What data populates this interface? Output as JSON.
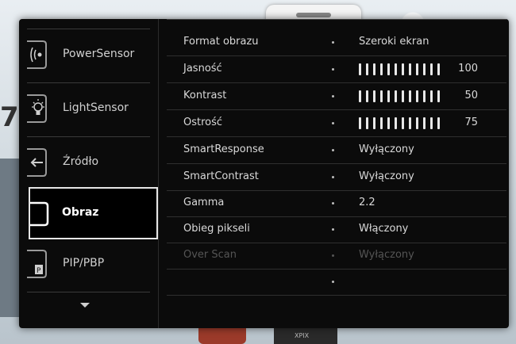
{
  "background": {
    "corner_digit": "7",
    "device_label": "XPIX"
  },
  "sidebar": {
    "items": [
      {
        "label": "PowerSensor",
        "icon": "power-sensor-icon"
      },
      {
        "label": "LightSensor",
        "icon": "light-sensor-icon"
      },
      {
        "label": "Źródło",
        "icon": "input-source-icon"
      },
      {
        "label": "Obraz",
        "icon": "picture-icon",
        "active": true
      },
      {
        "label": "PIP/PBP",
        "icon": "pip-icon"
      }
    ],
    "more_icon": "chevron-down-icon"
  },
  "settings": [
    {
      "name": "Format obrazu",
      "value": "Szeroki ekran"
    },
    {
      "name": "Jasność",
      "level": 100,
      "level_label": "100"
    },
    {
      "name": "Kontrast",
      "level": 50,
      "level_label": "50"
    },
    {
      "name": "Ostrość",
      "level": 75,
      "level_label": "75"
    },
    {
      "name": "SmartResponse",
      "value": "Wyłączony"
    },
    {
      "name": "SmartContrast",
      "value": "Wyłączony"
    },
    {
      "name": "Gamma",
      "value": "2.2"
    },
    {
      "name": "Obieg pikseli",
      "value": "Włączony"
    },
    {
      "name": "Over Scan",
      "value": "Wyłączony",
      "disabled": true
    },
    {
      "name": "",
      "value": ""
    }
  ],
  "colors": {
    "osd_bg": "#0b0b0b",
    "text": "#d9d9d9",
    "disabled": "#555555",
    "active_border": "#e6e6e6"
  }
}
